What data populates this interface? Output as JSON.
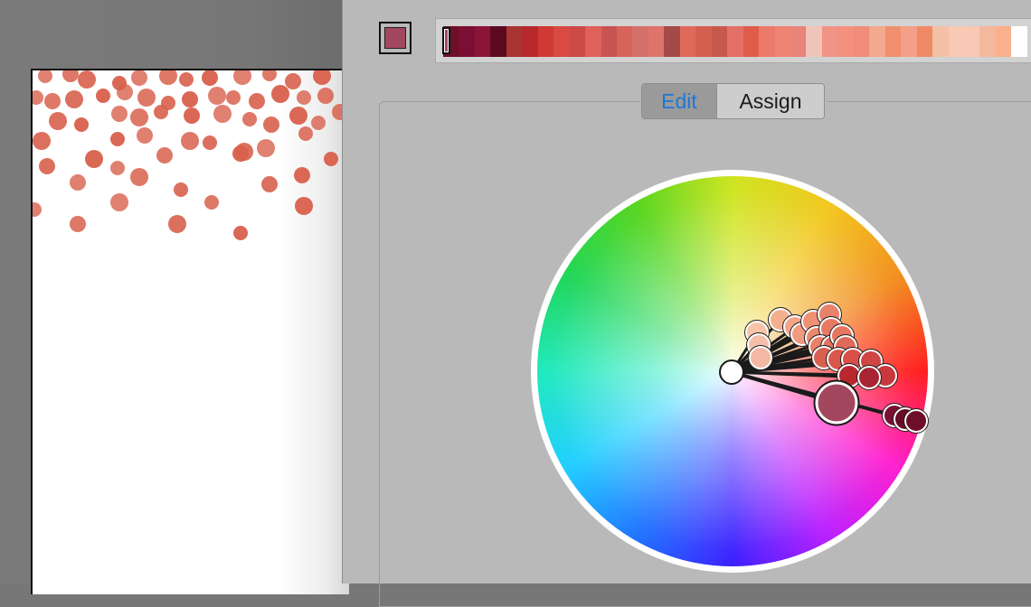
{
  "panel": {
    "current_color": "#a3475f",
    "accent": "#1b78d6",
    "tabs": [
      {
        "label": "Edit",
        "active": true
      },
      {
        "label": "Assign",
        "active": false
      }
    ]
  },
  "harmony_strip": {
    "colors": [
      "#6e0f2a",
      "#7c0d33",
      "#8a1536",
      "#5c0a20",
      "#a83434",
      "#b8282c",
      "#d03a34",
      "#d94a44",
      "#cc4a48",
      "#e0605a",
      "#c85452",
      "#d8635a",
      "#d4706a",
      "#de746c",
      "#a44a48",
      "#e06a5a",
      "#d45e50",
      "#c8584c",
      "#e47068",
      "#e05c4a",
      "#ec7a6a",
      "#f08474",
      "#e8847a",
      "#f0c4b8",
      "#f09488",
      "#f49080",
      "#f08c78",
      "#f4a88e",
      "#f0906e",
      "#f4a088",
      "#f08a64",
      "#f4c0a8",
      "#f6cab4",
      "#f8c8b4",
      "#f4b89c",
      "#fab08c",
      "#ffffff"
    ],
    "selected_index": 0
  },
  "wheel": {
    "base_color": "#ffffff",
    "selected_color": "#a3475f",
    "icons": [
      "color-wheel-icon",
      "base-color-marker-icon"
    ]
  },
  "canvas": {
    "confetti_color": "#d8604c"
  }
}
